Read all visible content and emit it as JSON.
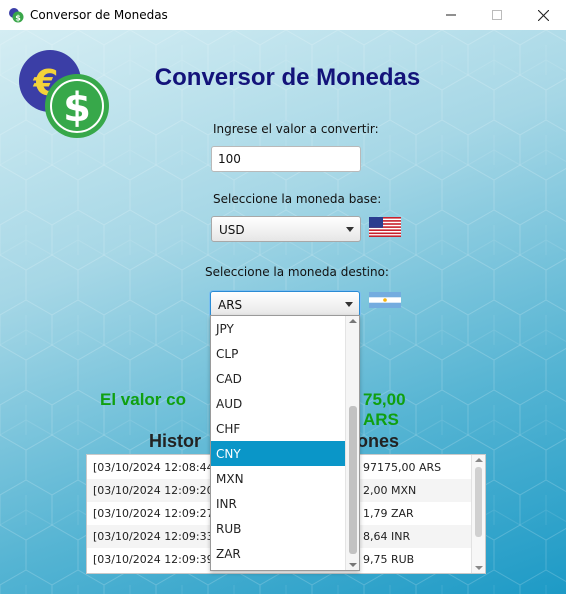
{
  "window": {
    "title": "Conversor de Monedas"
  },
  "app": {
    "title": "Conversor de Monedas"
  },
  "form": {
    "amount_label": "Ingrese el valor a convertir:",
    "amount_value": "100",
    "base_label": "Seleccione la moneda base:",
    "base_value": "USD",
    "target_label": "Seleccione la moneda destino:",
    "target_value": "ARS"
  },
  "result": {
    "text_visible_left": "El valor co",
    "text_visible_right": "75,00 ARS"
  },
  "history": {
    "title_visible_left": "Histor",
    "title_visible_right": "ones",
    "rows": [
      {
        "left": "[03/10/2024 12:08:44]",
        "right": "97175,00 ARS"
      },
      {
        "left": "[03/10/2024 12:09:20]",
        "right": "2,00 MXN"
      },
      {
        "left": "[03/10/2024 12:09:27]",
        "right": "1,79 ZAR"
      },
      {
        "left": "[03/10/2024 12:09:33]",
        "right": "8,64 INR"
      },
      {
        "left": "[03/10/2024 12:09:39]",
        "right": "9,75 RUB"
      }
    ]
  },
  "dropdown": {
    "options": [
      "JPY",
      "CLP",
      "CAD",
      "AUD",
      "CHF",
      "CNY",
      "MXN",
      "INR",
      "RUB",
      "ZAR"
    ],
    "highlighted": "CNY"
  },
  "colors": {
    "title": "#13137a",
    "result": "#10a010",
    "highlight": "#0a96c8"
  },
  "icons": {
    "logo": "currency-euro-dollar-icon",
    "base_flag": "us-flag-icon",
    "target_flag": "argentina-flag-icon"
  }
}
